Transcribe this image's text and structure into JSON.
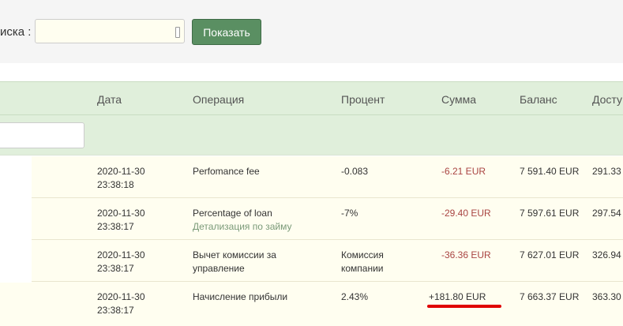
{
  "search": {
    "label": "иска :",
    "value": "",
    "button": "Показать"
  },
  "table": {
    "headers": [
      "Дата",
      "Операция",
      "Процент",
      "Сумма",
      "Баланс",
      "Досту"
    ],
    "rows": [
      {
        "date": "2020-11-30",
        "time": "23:38:18",
        "operation": "Perfomance fee",
        "operation_line2": "",
        "sub_link": "",
        "percent": "-0.083",
        "percent_line2": "",
        "amount": "-6.21 EUR",
        "amount_type": "neg",
        "balance": "7 591.40 EUR",
        "available": "291.33"
      },
      {
        "date": "2020-11-30",
        "time": "23:38:17",
        "operation": "Percentage of loan",
        "operation_line2": "",
        "sub_link": "Детализация по займу",
        "percent": "-7%",
        "percent_line2": "",
        "amount": "-29.40 EUR",
        "amount_type": "neg",
        "balance": "7 597.61 EUR",
        "available": "297.54"
      },
      {
        "date": "2020-11-30",
        "time": "23:38:17",
        "operation": "Вычет комиссии за",
        "operation_line2": "управление",
        "sub_link": "",
        "percent": "Комиссия",
        "percent_line2": "компании",
        "amount": "-36.36 EUR",
        "amount_type": "neg",
        "balance": "7 627.01 EUR",
        "available": "326.94"
      },
      {
        "date": "2020-11-30",
        "time": "23:38:17",
        "operation": "Начисление прибыли",
        "operation_line2": "",
        "sub_link": "",
        "percent": "2.43%",
        "percent_line2": "",
        "amount": "+181.80 EUR",
        "amount_type": "pos",
        "balance": "7 663.37 EUR",
        "available": "363.30"
      }
    ]
  },
  "colors": {
    "header_bg": "#e0efdb",
    "row_bg": "#fffef0",
    "button": "#5a8f62",
    "negative": "#a94442",
    "highlight": "#e00000"
  }
}
